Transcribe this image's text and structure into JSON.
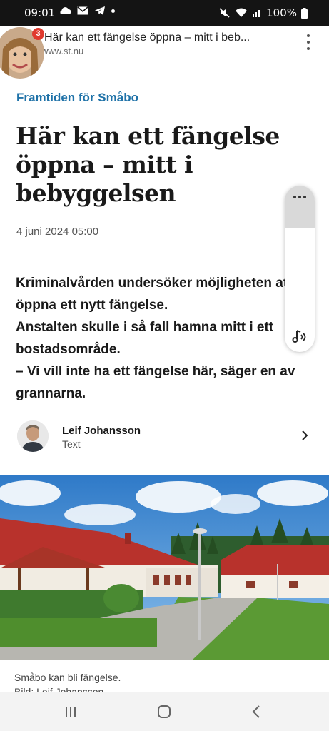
{
  "status": {
    "time": "09:01",
    "battery": "100%"
  },
  "browser": {
    "tab_count": "3",
    "page_title": "Här kan ett fängelse öppna – mitt i beb...",
    "url": "www.st.nu"
  },
  "article": {
    "section": "Framtiden för Småbo",
    "headline": "Här kan ett fängelse öppna – mitt i bebyggelsen",
    "date": "4 juni 2024 05:00",
    "lead": [
      "Kriminalvården undersöker möjligheten att öppna ett nytt fängelse.",
      "Anstalten skulle i så fall hamna mitt i ett bostadsområde.",
      "– Vi vill inte ha ett fängelse här, säger en av grannarna."
    ],
    "author": {
      "name": "Leif Johansson",
      "role": "Text"
    },
    "image_caption": "Småbo kan bli fängelse.",
    "image_credit": "Bild: Leif Johansson"
  },
  "colors": {
    "section_accent": "#1f72a8",
    "badge": "#e03a2e"
  },
  "icons": {
    "status_left": [
      "cloud-icon",
      "mail-icon",
      "telegram-icon",
      "dot-icon"
    ],
    "status_right": [
      "mute-icon",
      "wifi-icon",
      "signal-icon",
      "battery-icon"
    ],
    "audio": "listen-audio-icon",
    "nav": [
      "recent-apps-icon",
      "home-icon",
      "back-icon"
    ]
  }
}
